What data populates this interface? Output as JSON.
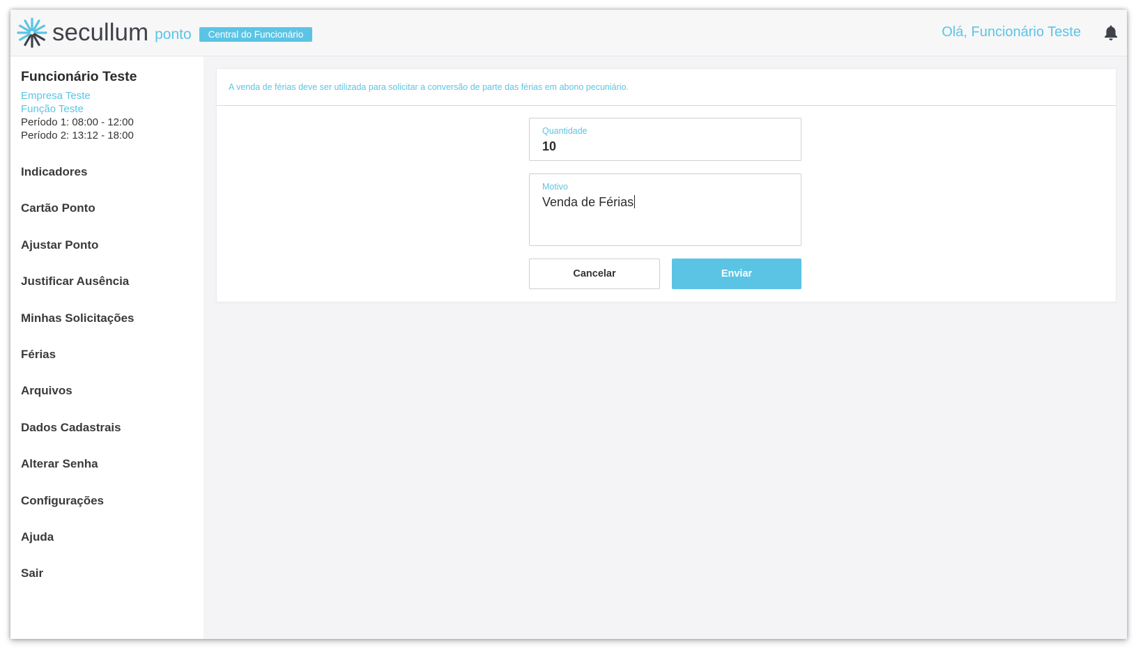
{
  "header": {
    "brand": "secullum",
    "product": "ponto",
    "badge": "Central do Funcionário",
    "greeting": "Olá, Funcionário Teste"
  },
  "employee": {
    "name": "Funcionário Teste",
    "company": "Empresa Teste",
    "role": "Função Teste",
    "period1": "Período 1: 08:00 - 12:00",
    "period2": "Período 2: 13:12 - 18:00"
  },
  "sidebar": {
    "items": [
      {
        "label": "Indicadores"
      },
      {
        "label": "Cartão Ponto"
      },
      {
        "label": "Ajustar Ponto"
      },
      {
        "label": "Justificar Ausência"
      },
      {
        "label": "Minhas Solicitações"
      },
      {
        "label": "Férias"
      },
      {
        "label": "Arquivos"
      },
      {
        "label": "Dados Cadastrais"
      },
      {
        "label": "Alterar Senha"
      },
      {
        "label": "Configurações"
      },
      {
        "label": "Ajuda"
      },
      {
        "label": "Sair"
      }
    ]
  },
  "main": {
    "info": "A venda de férias deve ser utilizada para solicitar a conversão de parte das férias em abono pecuniário.",
    "quantity": {
      "label": "Quantidade",
      "value": "10"
    },
    "reason": {
      "label": "Motivo",
      "value": "Venda de Férias"
    },
    "cancel_label": "Cancelar",
    "send_label": "Enviar"
  },
  "colors": {
    "accent": "#5bc4e5",
    "text": "#3a3a3a"
  },
  "icons": {
    "logo": "secullum-star-logo",
    "notification": "bell-icon"
  }
}
